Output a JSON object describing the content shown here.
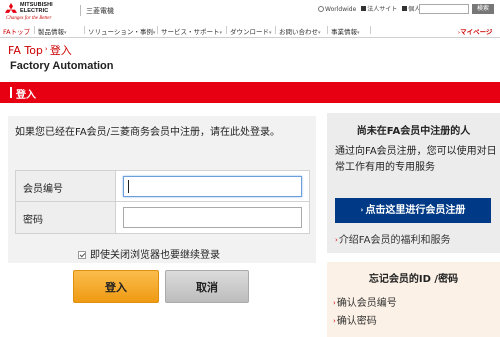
{
  "header": {
    "logo_name": "MITSUBISHI\nELECTRIC",
    "logo_slogan": "Changes for the Better",
    "company_jp": "三菱電機",
    "worldwide_label": "Worldwide",
    "sites_label": "法人サイト",
    "home_label": "個人のお客様",
    "search_button": "検索",
    "brand_color": "#e60012"
  },
  "nav": {
    "items": [
      "FAトップ",
      "製品情報",
      "ソリューション・事例",
      "サービス・サポート",
      "ダウンロード",
      "お問い合わせ",
      "事業情報"
    ],
    "mypage": "マイページ"
  },
  "breadcrumb": {
    "home": "FA Top",
    "current": "登入"
  },
  "site_title": "Factory Automation",
  "section_title": "登入",
  "login": {
    "intro": "如果您已经在FA会员/三菱商务会员中注册，请在此处登录。",
    "member_id_label": "会员编号",
    "member_id_value": "",
    "password_label": "密码",
    "password_value": "",
    "remember_label": "即使关闭浏览器也要继续登录",
    "remember_checked": true,
    "login_button": "登入",
    "cancel_button": "取消"
  },
  "register": {
    "title": "尚未在FA会员中注册的人",
    "desc": "通过向FA会员注册，您可以使用对日常工作有用的专用服务",
    "button": "点击这里进行会员注册",
    "benefits_link": "介绍FA会员的福利和服务"
  },
  "forgot": {
    "title": "忘记会员的ID /密码",
    "links": [
      "确认会员编号",
      "确认密码"
    ]
  }
}
